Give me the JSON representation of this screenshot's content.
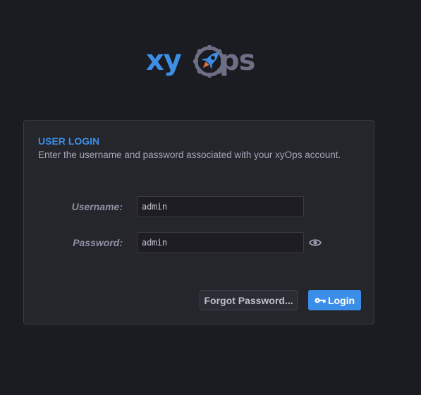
{
  "logo": {
    "text_left": "xy",
    "text_right": "ps",
    "icon": "rocket-gear-icon",
    "colors": {
      "blue": "#3d8ee6",
      "gray": "#6d6f85",
      "rocket_orange": "#e8703a"
    }
  },
  "login": {
    "title": "USER LOGIN",
    "description": "Enter the username and password associated with your xyOps account.",
    "username_label": "Username:",
    "username_value": "admin",
    "password_label": "Password:",
    "password_value": "admin",
    "show_password_icon": "eye-icon",
    "forgot_label": "Forgot Password...",
    "login_label": "Login",
    "login_icon": "key-icon"
  },
  "colors": {
    "background": "#1b1b22",
    "panel": "#25252c",
    "accent": "#3b8ee8"
  }
}
